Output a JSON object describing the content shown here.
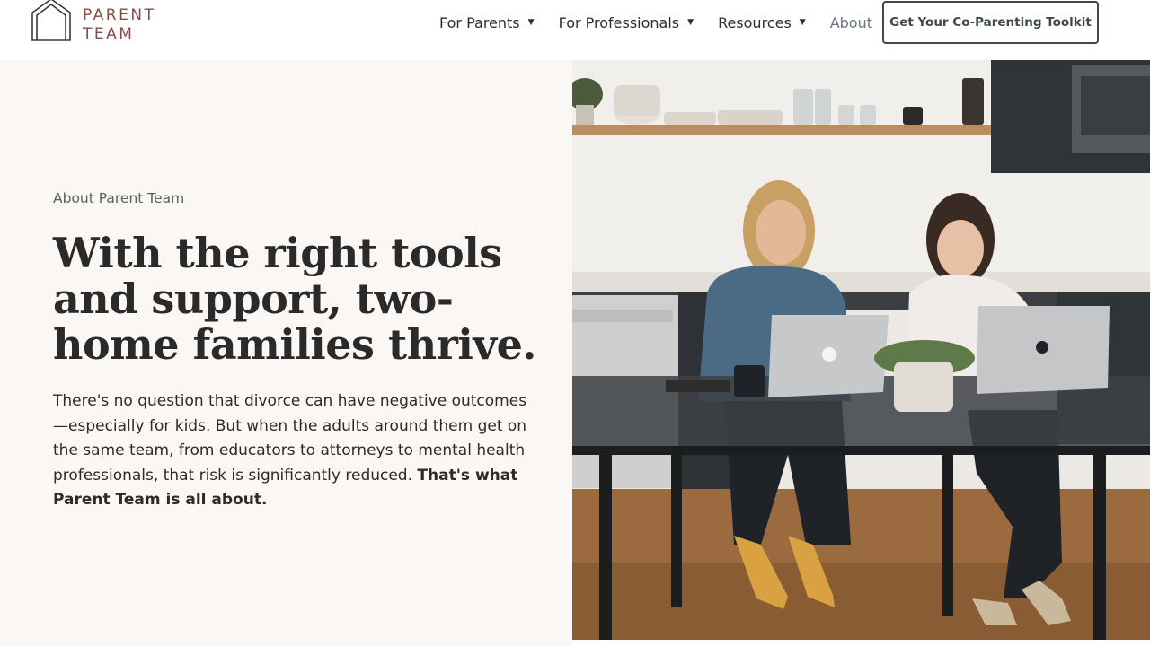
{
  "brand": {
    "line1": "PARENT",
    "line2": "TEAM"
  },
  "nav": {
    "items": [
      {
        "label": "For Parents",
        "has_dropdown": true
      },
      {
        "label": "For Professionals",
        "has_dropdown": true
      },
      {
        "label": "Resources",
        "has_dropdown": true
      },
      {
        "label": "About",
        "has_dropdown": false
      }
    ],
    "caret": "▼",
    "cta_label": "Get Your Co-Parenting Toolkit"
  },
  "hero": {
    "eyebrow": "About Parent Team",
    "headline": "With the right tools and support, two-home families thrive.",
    "body": "There's no question that divorce can have negative outcomes—especially for kids. But when the adults around them get on the same team, from educators to attorneys to mental health professionals, that risk is significantly reduced.",
    "body_emphasis": "That's what Parent Team is all about."
  },
  "colors": {
    "brand": "#8a4a45",
    "panel_bg": "#fbf7f4",
    "cta_border": "#3f4a47",
    "nav_active": "#6b7280"
  },
  "icons": {
    "logo": "house-outline-icon",
    "dropdown": "caret-down-icon"
  }
}
